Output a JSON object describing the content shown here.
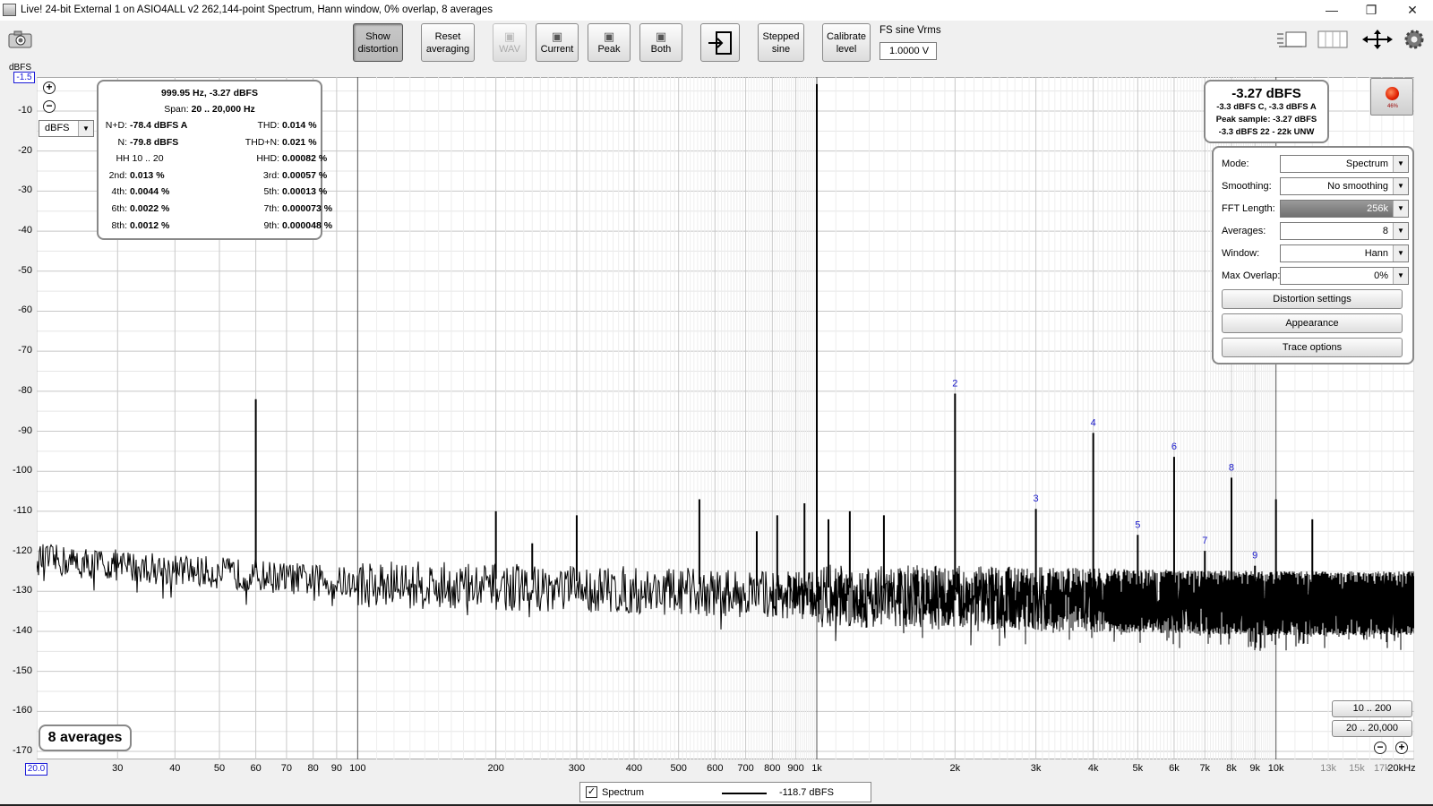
{
  "window": {
    "title": "Live! 24-bit External 1 on ASIO4ALL v2 262,144-point Spectrum, Hann window, 0% overlap, 8 averages",
    "minimize": "—",
    "maximize": "❐",
    "close": "✕"
  },
  "toolbar": {
    "show_distortion": [
      "Show",
      "distortion"
    ],
    "reset_averaging": [
      "Reset",
      "averaging"
    ],
    "wav": "WAV",
    "current": "Current",
    "peak": "Peak",
    "both": "Both",
    "stepped_sine": [
      "Stepped",
      "sine"
    ],
    "calibrate_level": [
      "Calibrate",
      "level"
    ],
    "fs_label": "FS sine Vrms",
    "fs_value": "1.0000 V"
  },
  "graph": {
    "y_unit": "dBFS",
    "y_top": "-1.5",
    "x_left": "20.0",
    "unit_select": "dBFS",
    "y_ticks": [
      "-10",
      "-20",
      "-30",
      "-40",
      "-50",
      "-60",
      "-70",
      "-80",
      "-90",
      "-100",
      "-110",
      "-120",
      "-130",
      "-140",
      "-150",
      "-160",
      "-170"
    ],
    "x_ticks": [
      "30",
      "40",
      "50",
      "60",
      "70",
      "80",
      "90",
      "100",
      "200",
      "300",
      "400",
      "500",
      "600",
      "700",
      "800",
      "900",
      "1k",
      "2k",
      "3k",
      "4k",
      "5k",
      "6k",
      "7k",
      "8k",
      "9k",
      "10k",
      "13k",
      "15k",
      "17k",
      "20kHz"
    ],
    "zoom_in": "+",
    "zoom_out": "−"
  },
  "distortion": {
    "header": "999.95 Hz, -3.27 dBFS",
    "span_label": "Span:",
    "span_value": "20 .. 20,000 Hz",
    "rows": [
      {
        "l1": "N+D:",
        "v1": "-78.4 dBFS A",
        "l2": "THD:",
        "v2": "0.014 %"
      },
      {
        "l1": "N:",
        "v1": "-79.8 dBFS",
        "l2": "THD+N:",
        "v2": "0.021 %"
      },
      {
        "l1": "HH 10 .. 20",
        "v1": "",
        "l2": "HHD:",
        "v2": "0.00082 %"
      },
      {
        "l1": "2nd:",
        "v1": "0.013 %",
        "l2": "3rd:",
        "v2": "0.00057 %"
      },
      {
        "l1": "4th:",
        "v1": "0.0044 %",
        "l2": "5th:",
        "v2": "0.00013 %"
      },
      {
        "l1": "6th:",
        "v1": "0.0022 %",
        "l2": "7th:",
        "v2": "0.000073 %"
      },
      {
        "l1": "8th:",
        "v1": "0.0012 %",
        "l2": "9th:",
        "v2": "0.000048 %"
      }
    ]
  },
  "level": {
    "main": "-3.27 dBFS",
    "line1": "-3.3 dBFS C, -3.3 dBFS A",
    "line2": "Peak sample: -3.27 dBFS",
    "line3": "-3.3 dBFS 22 - 22k UNW",
    "record_pct": "46%"
  },
  "settings": {
    "mode": {
      "label": "Mode:",
      "value": "Spectrum"
    },
    "smoothing": {
      "label": "Smoothing:",
      "value": "No  smoothing"
    },
    "fft": {
      "label": "FFT Length:",
      "value": "256k"
    },
    "averages": {
      "label": "Averages:",
      "value": "8"
    },
    "window": {
      "label": "Window:",
      "value": "Hann"
    },
    "overlap": {
      "label": "Max Overlap:",
      "value": "0%"
    },
    "distortion_settings": "Distortion settings",
    "appearance": "Appearance",
    "trace_options": "Trace options"
  },
  "bottom": {
    "averages_badge": "8 averages",
    "range_low": "10 .. 200",
    "range_full": "20 .. 20,000"
  },
  "legend": {
    "checked": "✓",
    "name": "Spectrum",
    "value": "-118.7 dBFS"
  },
  "chart_data": {
    "type": "line",
    "x_scale": "log",
    "xlim": [
      20,
      20000
    ],
    "ylim": [
      -172,
      -1.5
    ],
    "ylabel": "dBFS",
    "grid": true,
    "series": [
      {
        "name": "Spectrum",
        "color": "#000000"
      }
    ],
    "noise_floor": [
      [
        20,
        -122
      ],
      [
        100,
        -128
      ],
      [
        1000,
        -131
      ],
      [
        10000,
        -133
      ],
      [
        20000,
        -133
      ]
    ],
    "peaks": [
      {
        "x": 60,
        "y": -82
      },
      {
        "x": 200,
        "y": -110
      },
      {
        "x": 240,
        "y": -118
      },
      {
        "x": 300,
        "y": -111
      },
      {
        "x": 555,
        "y": -107
      },
      {
        "x": 740,
        "y": -115
      },
      {
        "x": 820,
        "y": -111
      },
      {
        "x": 940,
        "y": -108
      },
      {
        "x": 1000,
        "y": -3.27
      },
      {
        "x": 1060,
        "y": -112
      },
      {
        "x": 1180,
        "y": -110
      },
      {
        "x": 1400,
        "y": -111
      },
      {
        "x": 2000,
        "y": -80.6
      },
      {
        "x": 3000,
        "y": -109.4
      },
      {
        "x": 4000,
        "y": -90.4
      },
      {
        "x": 5000,
        "y": -115.9
      },
      {
        "x": 6000,
        "y": -96.4
      },
      {
        "x": 7000,
        "y": -119.9
      },
      {
        "x": 8000,
        "y": -101.6
      },
      {
        "x": 9000,
        "y": -123.6
      },
      {
        "x": 10000,
        "y": -107
      },
      {
        "x": 12000,
        "y": -112
      }
    ],
    "harmonic_labels": [
      {
        "label": "2",
        "x": 2000,
        "y": -80.6
      },
      {
        "label": "3",
        "x": 3000,
        "y": -109.4
      },
      {
        "label": "4",
        "x": 4000,
        "y": -90.4
      },
      {
        "label": "5",
        "x": 5000,
        "y": -115.9
      },
      {
        "label": "6",
        "x": 6000,
        "y": -96.4
      },
      {
        "label": "7",
        "x": 7000,
        "y": -119.9
      },
      {
        "label": "8",
        "x": 8000,
        "y": -101.6
      },
      {
        "label": "9",
        "x": 9000,
        "y": -123.6
      }
    ],
    "harmonic_label_color": "#1a1acc"
  }
}
